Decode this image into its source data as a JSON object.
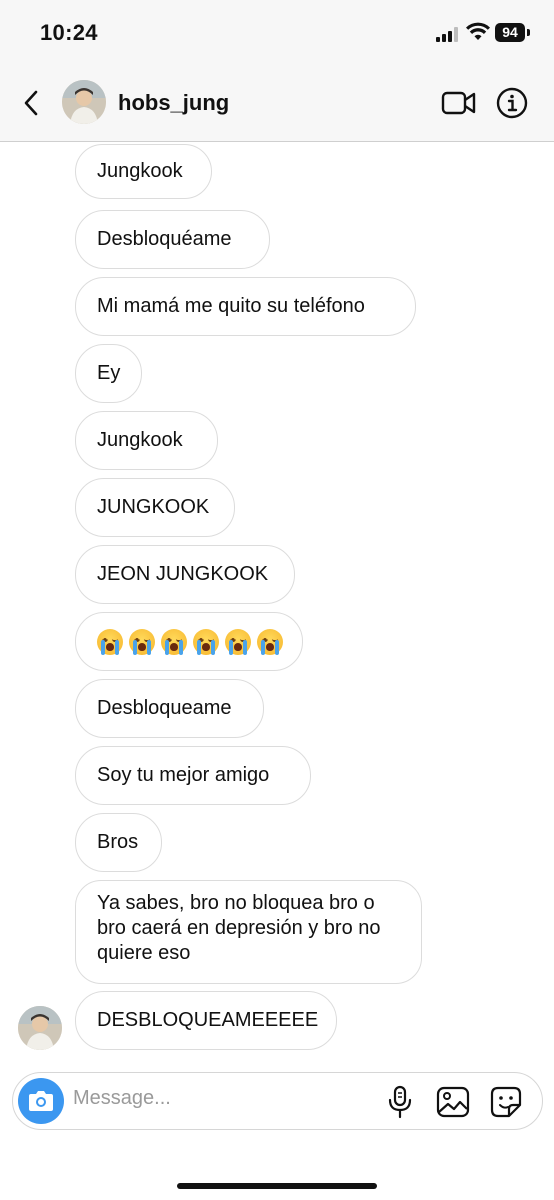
{
  "status_bar": {
    "time": "10:24",
    "battery": "94",
    "signal_icon": "cellular-signal-icon",
    "wifi_icon": "wifi-icon"
  },
  "header": {
    "username": "hobs_jung",
    "back_icon": "chevron-left-icon",
    "video_icon": "video-camera-icon",
    "info_icon": "info-icon"
  },
  "messages": [
    "Jungkook",
    "Desbloquéame",
    "Mi mamá me quito su teléfono",
    "Ey",
    "Jungkook",
    "JUNGKOOK",
    "JEON JUNGKOOK",
    "😭😭😭😭😭😭",
    "Desbloqueame",
    "Soy tu mejor amigo",
    "Bros",
    "Ya sabes, bro no bloquea bro o bro caerá en depresión y bro no quiere eso",
    "DESBLOQUEAMEEEEE"
  ],
  "composer": {
    "placeholder": "Message...",
    "camera_icon": "camera-icon",
    "mic_icon": "microphone-icon",
    "gallery_icon": "gallery-icon",
    "sticker_icon": "sticker-icon"
  },
  "colors": {
    "accent_blue": "#3b97f0",
    "bubble_border": "#dcdcdc",
    "header_bg": "#f7f7f7"
  }
}
